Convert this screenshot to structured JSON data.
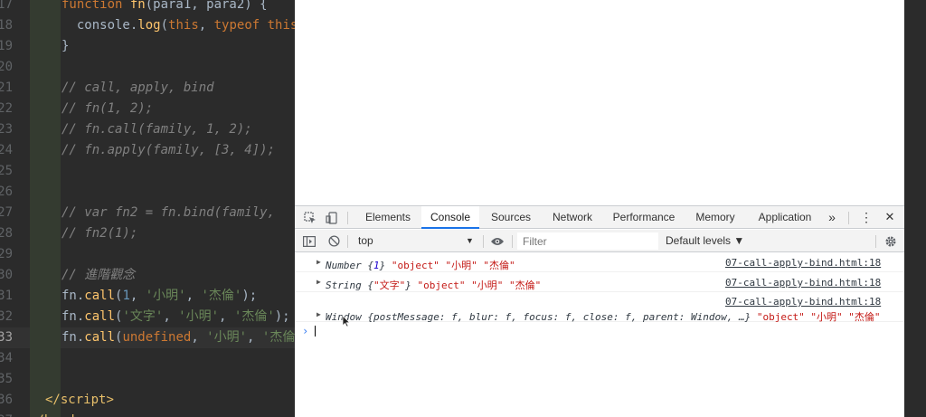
{
  "editor": {
    "lines": [
      {
        "num": "17",
        "tokens": [
          {
            "t": "function ",
            "c": "kw"
          },
          {
            "t": "fn",
            "c": "fn"
          },
          {
            "t": "(para1, para2) {",
            "c": "plain"
          }
        ]
      },
      {
        "num": "18",
        "tokens": [
          {
            "t": "  console",
            "c": "plain"
          },
          {
            "t": ".",
            "c": "plain"
          },
          {
            "t": "log",
            "c": "fn"
          },
          {
            "t": "(",
            "c": "plain"
          },
          {
            "t": "this",
            "c": "kw"
          },
          {
            "t": ", ",
            "c": "plain"
          },
          {
            "t": "typeof ",
            "c": "kw"
          },
          {
            "t": "this",
            "c": "kw"
          }
        ]
      },
      {
        "num": "19",
        "tokens": [
          {
            "t": "}",
            "c": "plain"
          }
        ]
      },
      {
        "num": "20",
        "tokens": []
      },
      {
        "num": "21",
        "tokens": [
          {
            "t": "// call, apply, bind",
            "c": "comment"
          }
        ]
      },
      {
        "num": "22",
        "tokens": [
          {
            "t": "// fn(1, 2);",
            "c": "comment"
          }
        ]
      },
      {
        "num": "23",
        "tokens": [
          {
            "t": "// fn.call(family, 1, 2);",
            "c": "comment"
          }
        ]
      },
      {
        "num": "24",
        "tokens": [
          {
            "t": "// fn.apply(family, [3, 4]);",
            "c": "comment"
          }
        ]
      },
      {
        "num": "25",
        "tokens": []
      },
      {
        "num": "26",
        "tokens": []
      },
      {
        "num": "27",
        "tokens": [
          {
            "t": "// var fn2 = fn.bind(family,",
            "c": "comment"
          }
        ]
      },
      {
        "num": "28",
        "tokens": [
          {
            "t": "// fn2(1);",
            "c": "comment"
          }
        ]
      },
      {
        "num": "29",
        "tokens": []
      },
      {
        "num": "30",
        "tokens": [
          {
            "t": "// 進階觀念",
            "c": "comment"
          }
        ]
      },
      {
        "num": "31",
        "tokens": [
          {
            "t": "fn",
            "c": "plain"
          },
          {
            "t": ".",
            "c": "plain"
          },
          {
            "t": "call",
            "c": "fn"
          },
          {
            "t": "(",
            "c": "plain"
          },
          {
            "t": "1",
            "c": "num"
          },
          {
            "t": ", ",
            "c": "plain"
          },
          {
            "t": "'小明'",
            "c": "str"
          },
          {
            "t": ", ",
            "c": "plain"
          },
          {
            "t": "'杰倫'",
            "c": "str"
          },
          {
            "t": ");",
            "c": "plain"
          }
        ]
      },
      {
        "num": "32",
        "tokens": [
          {
            "t": "fn",
            "c": "plain"
          },
          {
            "t": ".",
            "c": "plain"
          },
          {
            "t": "call",
            "c": "fn"
          },
          {
            "t": "(",
            "c": "plain"
          },
          {
            "t": "'文字'",
            "c": "str"
          },
          {
            "t": ", ",
            "c": "plain"
          },
          {
            "t": "'小明'",
            "c": "str"
          },
          {
            "t": ", ",
            "c": "plain"
          },
          {
            "t": "'杰倫'",
            "c": "str"
          },
          {
            "t": ");",
            "c": "plain"
          }
        ]
      },
      {
        "num": "33",
        "active": true,
        "tokens": [
          {
            "t": "fn",
            "c": "plain"
          },
          {
            "t": ".",
            "c": "plain"
          },
          {
            "t": "call",
            "c": "fn"
          },
          {
            "t": "(",
            "c": "plain"
          },
          {
            "t": "undefined",
            "c": "kw"
          },
          {
            "t": ", ",
            "c": "plain"
          },
          {
            "t": "'小明'",
            "c": "str"
          },
          {
            "t": ", ",
            "c": "plain"
          },
          {
            "t": "'杰倫'",
            "c": "str"
          }
        ]
      },
      {
        "num": "34",
        "tokens": []
      },
      {
        "num": "35",
        "tokens": []
      },
      {
        "num": "36",
        "tokens": [
          {
            "t": "</",
            "c": "tag"
          },
          {
            "t": "script",
            "c": "tag"
          },
          {
            "t": ">",
            "c": "tag"
          }
        ]
      },
      {
        "num": "37",
        "tokens": [
          {
            "t": "</",
            "c": "tag"
          },
          {
            "t": "head",
            "c": "tag"
          },
          {
            "t": ">",
            "c": "tag"
          }
        ]
      }
    ]
  },
  "devtools": {
    "tabs": [
      {
        "label": "Elements"
      },
      {
        "label": "Console",
        "active": true
      },
      {
        "label": "Sources"
      },
      {
        "label": "Network"
      },
      {
        "label": "Performance"
      },
      {
        "label": "Memory"
      },
      {
        "label": "Application"
      }
    ],
    "more_tabs": "»",
    "menu_glyph": "⋮",
    "close_glyph": "✕",
    "toolbar": {
      "context": "top",
      "context_arrow": "▼",
      "filter_placeholder": "Filter",
      "levels": "Default levels ▼"
    },
    "console": {
      "rows": [
        {
          "source": "07-call-apply-bind.html:18",
          "parts": [
            {
              "t": "Number ",
              "c": "obj"
            },
            {
              "t": "{",
              "c": "obj"
            },
            {
              "t": "1",
              "c": "num"
            },
            {
              "t": "}",
              "c": "obj"
            },
            {
              "t": " \"object\" \"小明\" \"杰倫\"",
              "c": "str"
            }
          ]
        },
        {
          "source": "07-call-apply-bind.html:18",
          "parts": [
            {
              "t": "String ",
              "c": "obj"
            },
            {
              "t": "{",
              "c": "obj"
            },
            {
              "t": "\"文字\"",
              "c": "str"
            },
            {
              "t": "}",
              "c": "obj"
            },
            {
              "t": " \"object\" \"小明\" \"杰倫\"",
              "c": "str"
            }
          ]
        },
        {
          "source": "07-call-apply-bind.html:18",
          "parts": [
            {
              "t": "Window ",
              "c": "obj"
            },
            {
              "t": "{postMessage: f, blur: f, focus: f, close: f, parent: Window, …}",
              "c": "gray"
            },
            {
              "t": " \"object\" \"小明\" \"杰倫\"",
              "c": "str"
            }
          ]
        }
      ],
      "prompt": "›"
    }
  },
  "colors": {
    "editor_bg": "#2b2b2b",
    "accent": "#1a73e8",
    "console_string": "#c41a16"
  }
}
